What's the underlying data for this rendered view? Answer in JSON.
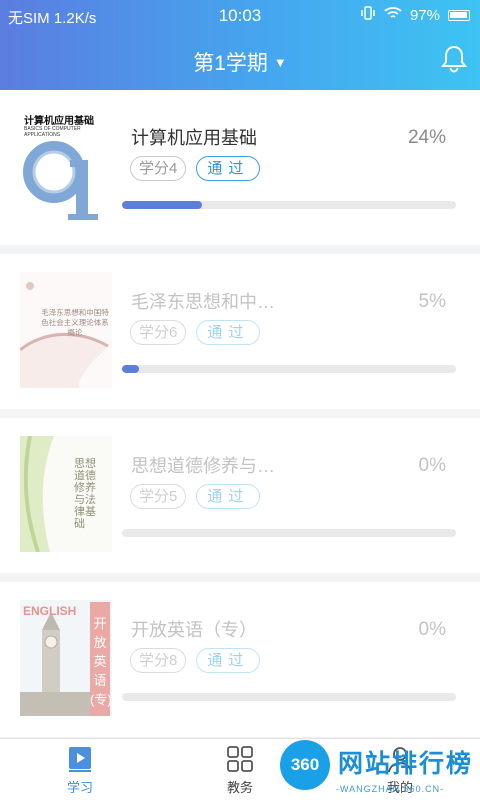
{
  "status_bar": {
    "carrier": "无SIM",
    "speed": "1.2K/s",
    "time": "10:03",
    "battery": "97%"
  },
  "header": {
    "term": "第1学期",
    "caret": "▼"
  },
  "courses": [
    {
      "title": "计算机应用基础",
      "percent": "24%",
      "progress": 0.24,
      "credit": "学分4",
      "status": "通过",
      "cover": {
        "title": "计算机应用基础",
        "subtitle": "BASICS OF COMPUTER APPLICATIONS"
      }
    },
    {
      "title": "毛泽东思想和中…",
      "percent": "5%",
      "progress": 0.05,
      "credit": "学分6",
      "status": "通过",
      "cover": {
        "title": "毛泽东思想和中国特色社会主义理论体系概论"
      }
    },
    {
      "title": "思想道德修养与…",
      "percent": "0%",
      "progress": 0,
      "credit": "学分5",
      "status": "通过",
      "cover": {
        "title": "思想道德修养与法律基础"
      }
    },
    {
      "title": "开放英语（专）",
      "percent": "0%",
      "progress": 0,
      "credit": "学分8",
      "status": "通过",
      "cover": {
        "title": "ENGLISH",
        "vertical": "开放英语(专)"
      }
    }
  ],
  "tabbar": {
    "items": [
      {
        "label": "学习"
      },
      {
        "label": "教务"
      },
      {
        "label": "我的"
      }
    ]
  },
  "watermark": {
    "badge": "360",
    "title": "网站排行榜",
    "url": "-WANGZHAN.360.CN-"
  },
  "colors": {
    "accent": "#3e8fe0",
    "progress_fill": "#5c7fd8",
    "header_start": "#5b7de0",
    "header_end": "#3ec3f2"
  }
}
